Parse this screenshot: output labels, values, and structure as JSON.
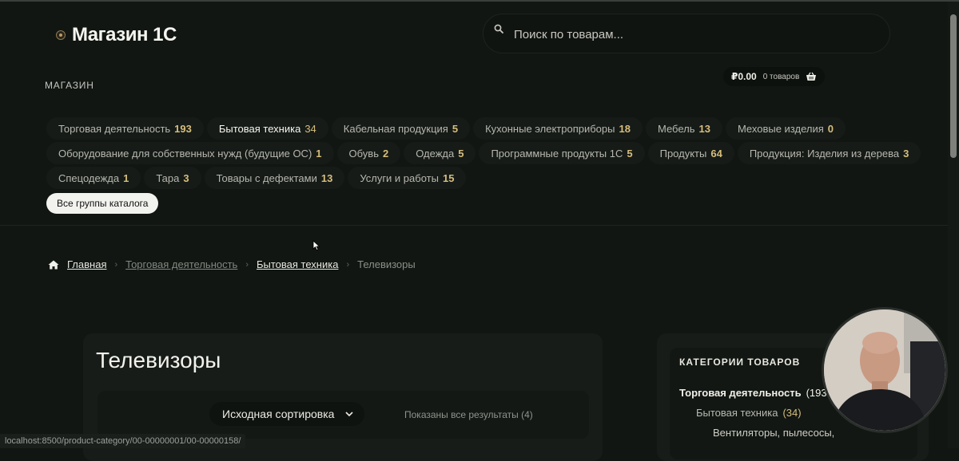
{
  "header": {
    "logo_text": "Магазин 1С",
    "search_placeholder": "Поиск по товарам...",
    "nav_shop": "МАГАЗИН",
    "cart_total": "₽0.00",
    "cart_count": "0 товаров"
  },
  "categories": {
    "rows": [
      [
        {
          "label": "Торговая деятельность",
          "count": "193"
        },
        {
          "label": "Бытовая техника",
          "count": "34",
          "active": true
        },
        {
          "label": "Кабельная продукция",
          "count": "5"
        },
        {
          "label": "Кухонные электроприборы",
          "count": "18"
        },
        {
          "label": "Мебель",
          "count": "13"
        },
        {
          "label": "Меховые изделия",
          "count": "0"
        }
      ],
      [
        {
          "label": "Оборудование для собственных нужд (будущие ОС)",
          "count": "1"
        },
        {
          "label": "Обувь",
          "count": "2"
        },
        {
          "label": "Одежда",
          "count": "5"
        },
        {
          "label": "Программные продукты 1С",
          "count": "5"
        },
        {
          "label": "Продукты",
          "count": "64"
        },
        {
          "label": "Продукция: Изделия из дерева",
          "count": "3"
        }
      ],
      [
        {
          "label": "Спецодежда",
          "count": "1"
        },
        {
          "label": "Тара",
          "count": "3"
        },
        {
          "label": "Товары с дефектами",
          "count": "13"
        },
        {
          "label": "Услуги и работы",
          "count": "15"
        }
      ]
    ],
    "all_groups_label": "Все группы каталога"
  },
  "breadcrumb": {
    "home": "Главная",
    "level1": "Торговая деятельность",
    "level2": "Бытовая техника",
    "current": "Телевизоры"
  },
  "main": {
    "title": "Телевизоры",
    "sort_label": "Исходная сортировка",
    "results_text": "Показаны все результаты (4)"
  },
  "sidebar": {
    "title": "КАТЕГОРИИ ТОВАРОВ",
    "items": [
      {
        "label": "Торговая деятельность",
        "count": "(193"
      },
      {
        "label": "Бытовая техника",
        "count": "(34)"
      },
      {
        "label": "Вентиляторы, пылесосы,"
      }
    ]
  },
  "status_bar": {
    "url": "localhost:8500/product-category/00-00000001/00-00000158/"
  },
  "colors": {
    "background": "#111612",
    "accent_gold": "#d6bd7c",
    "card": "#171c18"
  }
}
